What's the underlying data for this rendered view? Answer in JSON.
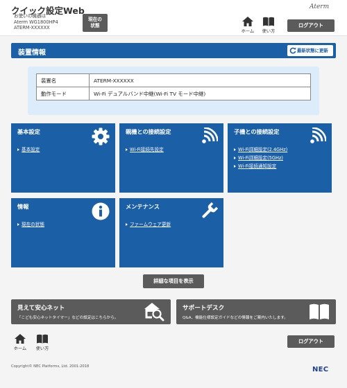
{
  "header": {
    "app_title": "クイック設定Web",
    "device_label": "お使いの機器は",
    "model": "Aterm WG1800HP4",
    "device_id": "ATERM-XXXXXX",
    "status_button": "現在の状態",
    "brand": "Aterm",
    "home_label": "ホーム",
    "manual_label": "使い方",
    "logout_label": "ログアウト"
  },
  "section": {
    "title": "装置情報",
    "refresh_label": "最新状態に更新"
  },
  "info_table": [
    {
      "label": "装置名",
      "value": "ATERM-XXXXXX"
    },
    {
      "label": "動作モード",
      "value": "Wi-Fi デュアルバンド中継(Wi-Fi TV モード中継)"
    }
  ],
  "tiles": {
    "basic": {
      "title": "基本設定",
      "links": [
        "基本設定"
      ],
      "icon": "gear-icon"
    },
    "parent": {
      "title": "親機との接続設定",
      "links": [
        "Wi-Fi接続先設定"
      ],
      "icon": "wifi-icon"
    },
    "child": {
      "title": "子機との接続設定",
      "links": [
        "Wi-Fi詳細設定(2.4GHz)",
        "Wi-Fi詳細設定(5GHz)",
        "Wi-Fi接続通知設定"
      ],
      "icon": "wifi-icon"
    },
    "info": {
      "title": "情報",
      "links": [
        "現在の状態"
      ],
      "icon": "info-icon"
    },
    "maintenance": {
      "title": "メンテナンス",
      "links": [
        "ファームウェア更新"
      ],
      "icon": "wrench-icon"
    }
  },
  "advanced_button": "詳細な項目を表示",
  "banners": {
    "safety": {
      "title": "見えて安心ネット",
      "text": "「こども安心ネットタイマー」などの設定はこちらから。",
      "icon": "house-search-icon"
    },
    "support": {
      "title": "サポートデスク",
      "text": "Q&A、機能仕様設定ガイドなどの情報をご案内いたします。",
      "icon": "book-icon"
    }
  },
  "footer": {
    "copyright": "Copyright© NEC Platforms, Ltd. 2001-2018",
    "logo": "NEC",
    "home_label": "ホーム",
    "manual_label": "使い方",
    "logout_label": "ログアウト"
  },
  "colors": {
    "primary": "#1b5fa7",
    "panel": "#dcecfa",
    "button_dark": "#5b5b5b",
    "background": "#f4f4f4"
  }
}
